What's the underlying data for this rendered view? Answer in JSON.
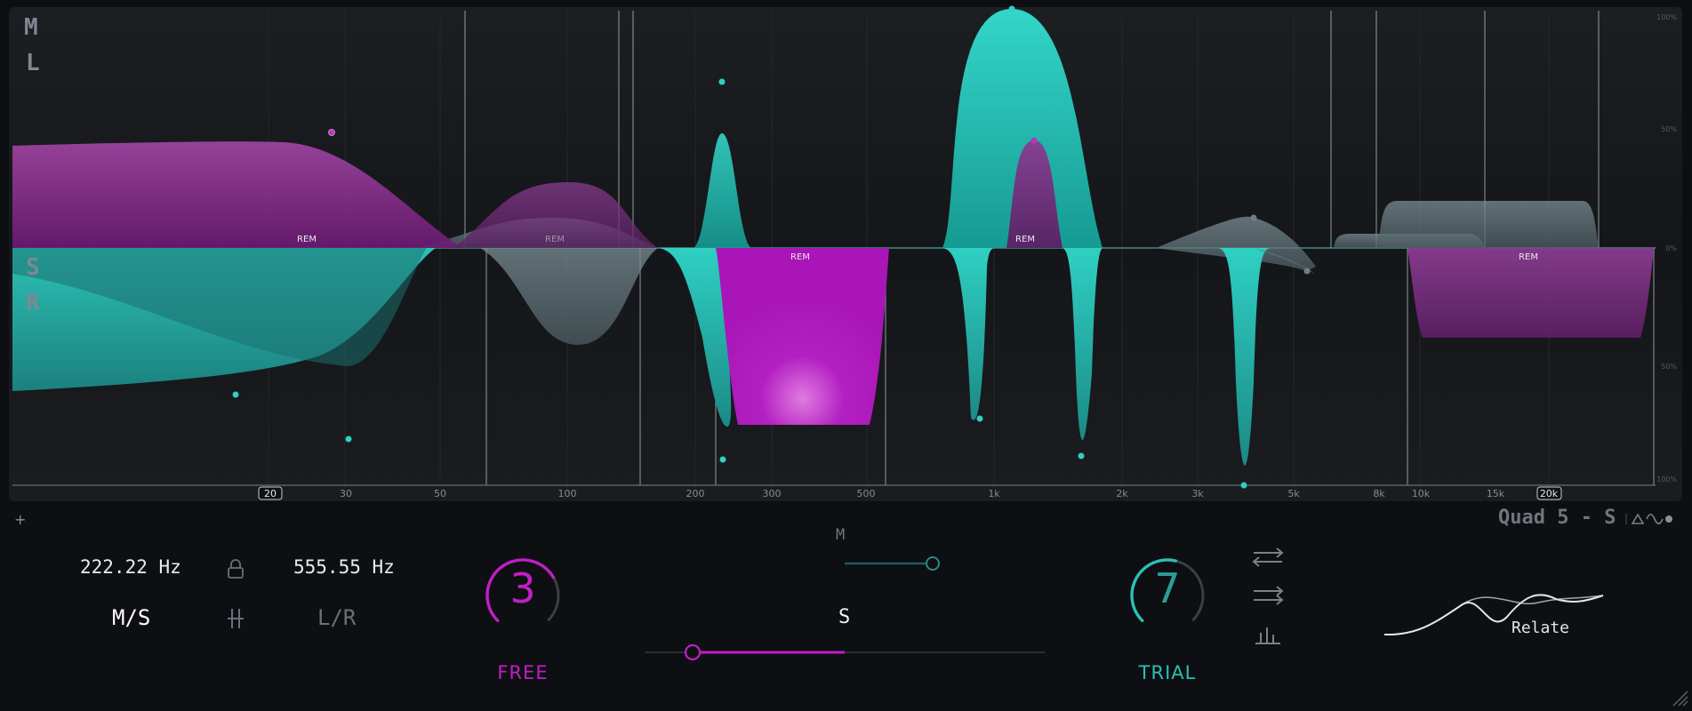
{
  "channels": {
    "m": "M",
    "l": "L",
    "s": "S",
    "r": "R"
  },
  "band_tags": [
    "REM",
    "REM",
    "REM",
    "REM",
    "REM"
  ],
  "ticks": [
    "20",
    "30",
    "50",
    "100",
    "200",
    "300",
    "500",
    "1k",
    "2k",
    "3k",
    "5k",
    "8k",
    "10k",
    "15k",
    "20k"
  ],
  "boxed_ticks": [
    "20",
    "20k"
  ],
  "scale": {
    "top": "100%",
    "mid_high": "50%",
    "zero": "0%",
    "mid_low": "50%",
    "bottom": "100%"
  },
  "add_label": "+",
  "preset": {
    "name": "Quad 5 - S"
  },
  "band": {
    "low_freq": "222.22 Hz",
    "high_freq": "555.55 Hz",
    "mode_left": "M/S",
    "mode_right": "L/R"
  },
  "knobs": {
    "left": {
      "value": "3",
      "label": "FREE",
      "color": "#c21ec4",
      "level": 0.72
    },
    "right": {
      "value": "7",
      "label": "TRIAL",
      "color": "#2bbfb6",
      "level": 0.55
    }
  },
  "sliders": {
    "m_label": "M",
    "m_level": 0.72,
    "s_label": "S",
    "s_level": 0.12
  },
  "relate": {
    "label": "Relate"
  },
  "colors": {
    "teal": "#28c9bd",
    "magenta": "#b11fbe",
    "bg": "#141619"
  }
}
